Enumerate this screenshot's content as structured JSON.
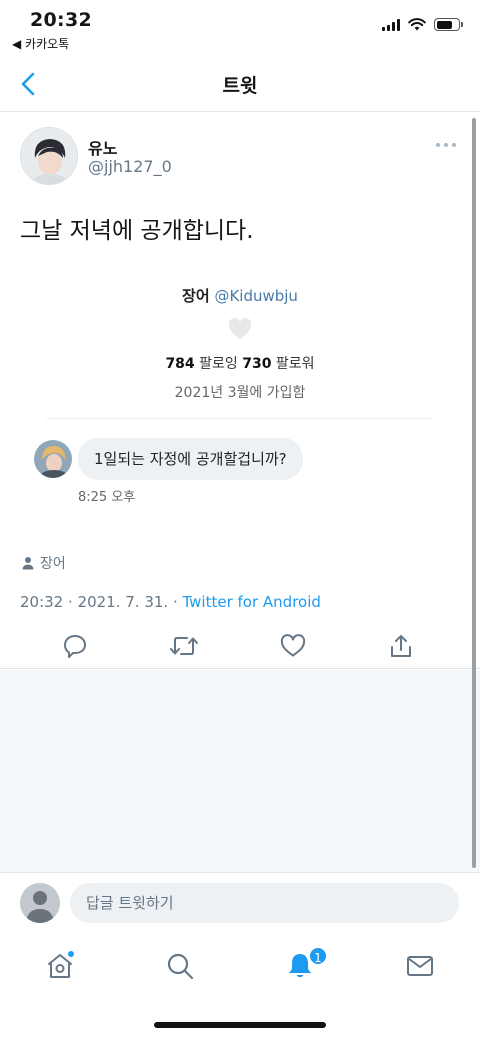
{
  "status_bar": {
    "time": "20:32",
    "back_label": "◀ 카카오톡"
  },
  "header": {
    "title": "트윗"
  },
  "tweet": {
    "display_name": "유노",
    "handle": "@jjh127_0",
    "text": "그날 저녁에 공개합니다.",
    "embedded": {
      "profile_name": "장어",
      "profile_handle": "@Kiduwbju",
      "following_count": "784",
      "following_label": "팔로잉",
      "followers_count": "730",
      "followers_label": "팔로워",
      "joined": "2021년 3월에 가입함",
      "message": "1일되는 자정에 공개할겁니까?",
      "message_time": "8:25 오후"
    },
    "reply_context": "장어",
    "meta_datetime": "20:32 · 2021. 7. 31. · ",
    "meta_source": "Twitter for Android"
  },
  "composer": {
    "placeholder": "답글 트윗하기"
  },
  "tab_bar": {
    "notifications_badge": "1"
  },
  "colors": {
    "accent": "#1d9bf0",
    "secondary_text": "#657786",
    "divider": "#e1e4e6"
  }
}
